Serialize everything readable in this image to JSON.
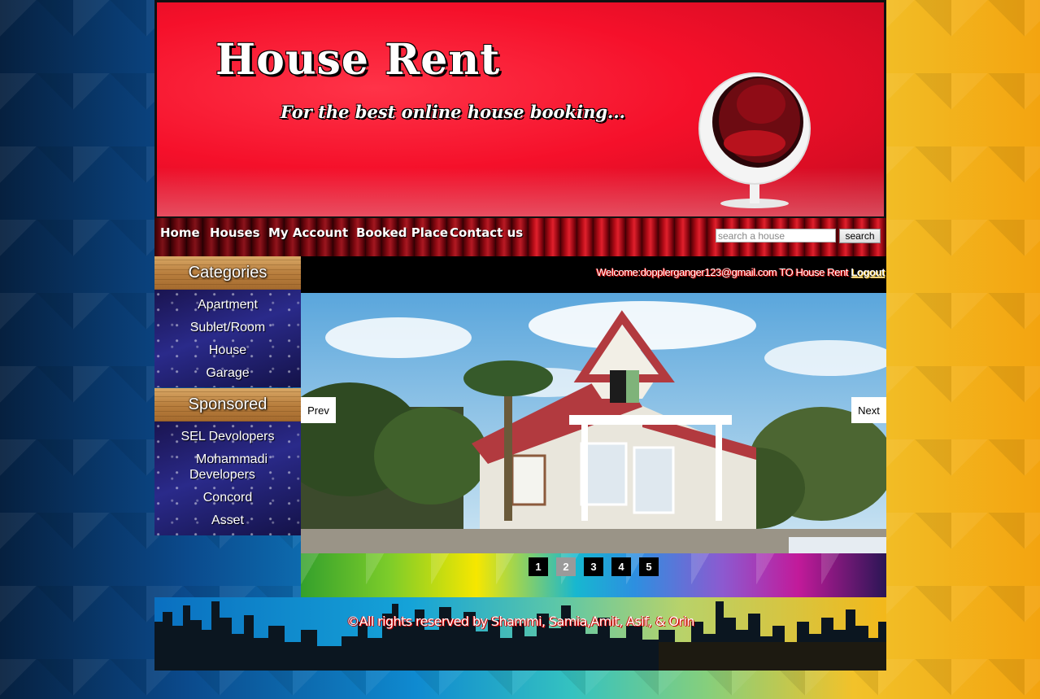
{
  "header": {
    "title": "House Rent",
    "tagline": "For the best online house booking..."
  },
  "nav": {
    "items": [
      {
        "label": "Home"
      },
      {
        "label": "Houses"
      },
      {
        "label": "My Account"
      },
      {
        "label": "Booked Place"
      },
      {
        "label": "Contact us"
      }
    ],
    "search_placeholder": "search a house",
    "search_button": "search"
  },
  "sidebar": {
    "categories_title": "Categories",
    "categories": [
      "Apartment",
      "Sublet/Room",
      "House",
      "Garage"
    ],
    "sponsored_title": "Sponsored",
    "sponsored": [
      "SEL Devolopers",
      "Mohammadi Developers",
      "Concord",
      "Asset"
    ]
  },
  "welcome": {
    "text": "Welcome:dopplerganger123@gmail.com TO House Rent ",
    "logout": "Logout"
  },
  "slider": {
    "prev": "Prev",
    "next": "Next",
    "pages": [
      "1",
      "2",
      "3",
      "4",
      "5"
    ],
    "active_page": "2"
  },
  "footer": {
    "copyright": "©All rights reserved by Shammi, Samia,Amit, Asif, & Orin"
  },
  "colors": {
    "banner_red": "#f5102a",
    "active_page": "#9a9a9a"
  }
}
